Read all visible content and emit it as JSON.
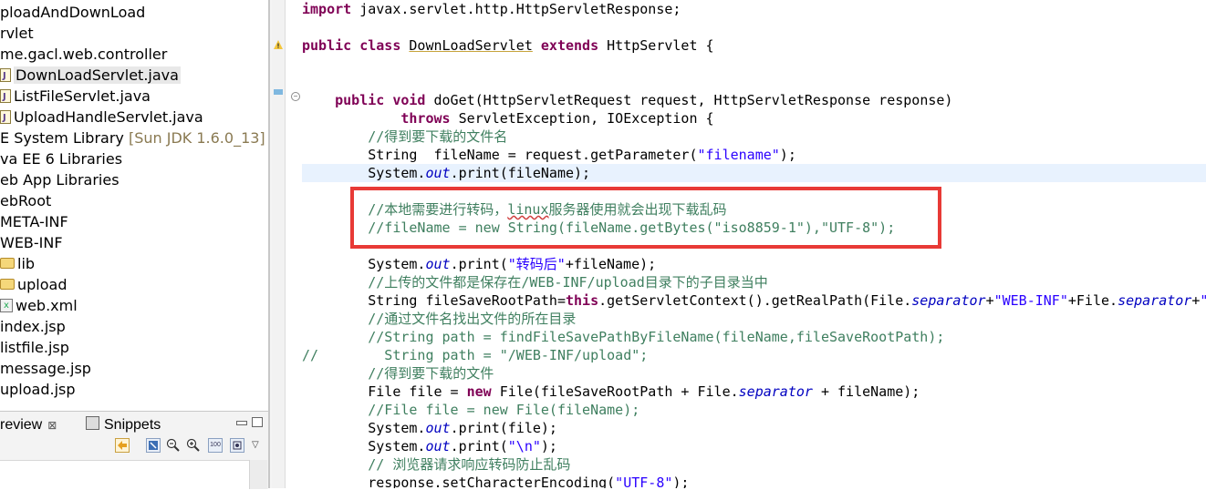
{
  "explorer": {
    "items": [
      {
        "text": "ploadAndDownLoad",
        "indent": 0,
        "icon": "none"
      },
      {
        "text": "rvlet",
        "indent": 0,
        "icon": "none"
      },
      {
        "text": "me.gacl.web.controller",
        "indent": 0,
        "icon": "none"
      },
      {
        "text": "DownLoadServlet.java",
        "indent": 0,
        "icon": "java-file-icon",
        "selected": true
      },
      {
        "text": "ListFileServlet.java",
        "indent": 0,
        "icon": "java-file-icon"
      },
      {
        "text": "UploadHandleServlet.java",
        "indent": 0,
        "icon": "java-file-icon"
      },
      {
        "text": "E System Library",
        "suffix": "[Sun JDK 1.6.0_13]",
        "indent": 0,
        "icon": "none"
      },
      {
        "text": "va EE 6 Libraries",
        "indent": 0,
        "icon": "none"
      },
      {
        "text": "eb App Libraries",
        "indent": 0,
        "icon": "none"
      },
      {
        "text": "ebRoot",
        "indent": 0,
        "icon": "none"
      },
      {
        "text": "META-INF",
        "indent": 0,
        "icon": "none"
      },
      {
        "text": "WEB-INF",
        "indent": 0,
        "icon": "none"
      },
      {
        "text": "lib",
        "indent": 0,
        "icon": "folder-icon"
      },
      {
        "text": "upload",
        "indent": 0,
        "icon": "folder-icon"
      },
      {
        "text": "web.xml",
        "indent": 0,
        "icon": "xml-file-icon"
      },
      {
        "text": "index.jsp",
        "indent": 0,
        "icon": "none"
      },
      {
        "text": "listfile.jsp",
        "indent": 0,
        "icon": "none"
      },
      {
        "text": "message.jsp",
        "indent": 0,
        "icon": "none"
      },
      {
        "text": "upload.jsp",
        "indent": 0,
        "icon": "none"
      }
    ]
  },
  "lower_panel": {
    "tab_preview": "review",
    "tab_preview_close": "⊠",
    "tab_snippets": "Snippets"
  },
  "editor": {
    "lines": [
      "<span class=\"kw\">import</span> javax.servlet.http.HttpServletResponse;",
      "",
      "<span class=\"kw\">public</span> <span class=\"kw\">class</span> <span class=\"ul\">DownLoadServlet</span> <span class=\"kw\">extends</span> HttpServlet {",
      "",
      "",
      "    <span class=\"kw\">public</span> <span class=\"kw\">void</span> doGet(HttpServletRequest request, HttpServletResponse response)",
      "            <span class=\"kw\">throws</span> ServletException, IOException {",
      "        <span class=\"cm\">//得到要下载的文件名</span>",
      "        String  fileName = request.getParameter(<span class=\"str\">\"filename\"</span>);",
      "        System.<span class=\"fld\">out</span>.print(fileName);",
      "",
      "        <span class=\"cm\">//本地需要进行转码，<span class=\"ulr\">linux</span>服务器使用就会出现下载乱码</span>",
      "        <span class=\"cm\">//fileName = new String(fileName.getBytes(\"iso8859-1\"),\"UTF-8\");</span>",
      "",
      "        System.<span class=\"fld\">out</span>.print(<span class=\"str\">\"转码后\"</span>+fileName);",
      "        <span class=\"cm\">//上传的文件都是保存在/WEB-INF/upload目录下的子目录当中</span>",
      "        String fileSaveRootPath=<span class=\"kw\">this</span>.getServletContext().getRealPath(File.<span class=\"fld\">separator</span>+<span class=\"str\">\"WEB-INF\"</span>+File.<span class=\"fld\">separator</span>+<span class=\"str\">\"upload\"</span>);",
      "        <span class=\"cm\">//通过文件名找出文件的所在目录</span>",
      "        <span class=\"cm\">//String path = findFileSavePathByFileName(fileName,fileSaveRootPath);</span>",
      "<span class=\"cm\">//        String path = \"/WEB-INF/upload\";</span>",
      "        <span class=\"cm\">//得到要下载的文件</span>",
      "        File file = <span class=\"kw\">new</span> File(fileSaveRootPath + File.<span class=\"fld\">separator</span> + fileName);",
      "        <span class=\"cm\">//File file = new File(fileName);</span>",
      "        System.<span class=\"fld\">out</span>.print(file);",
      "        System.<span class=\"fld\">out</span>.print(<span class=\"str\">\"\\n\"</span>);",
      "        <span class=\"cm\">// 浏览器请求响应转码防止乱码</span>",
      "        response.setCharacterEncoding(<span class=\"str\">\"UTF-8\"</span>);"
    ],
    "current_line": 9
  }
}
